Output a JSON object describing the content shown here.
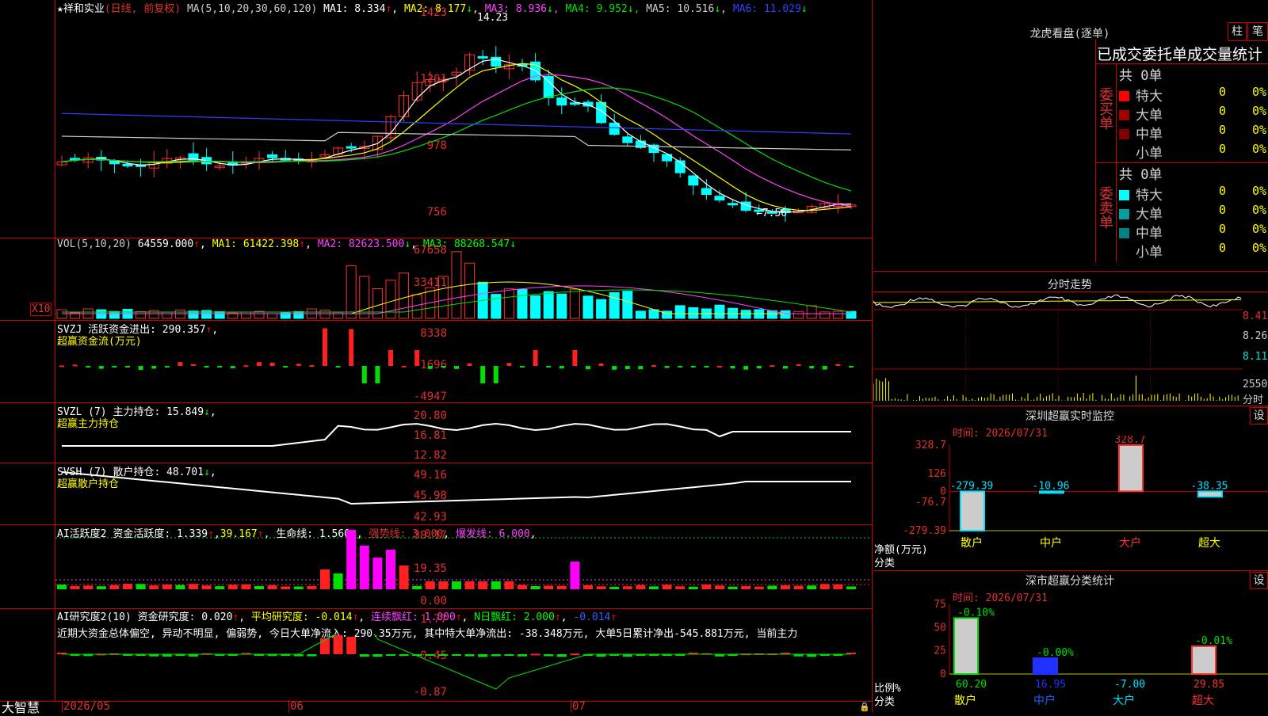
{
  "header": {
    "stock": "★祥和实业",
    "period": "(日线, 前复权)",
    "ma_params": "MA(5,10,20,30,60,120)",
    "ma": [
      {
        "label": "MA1: 8.334",
        "arrow": "↑",
        "color": "#ffffff"
      },
      {
        "label": "MA2: 8.177",
        "arrow": "↓",
        "color": "#ffff00"
      },
      {
        "label": "MA3: 8.936",
        "arrow": "↓",
        "color": "#ff40ff"
      },
      {
        "label": "MA4: 9.952",
        "arrow": "↓",
        "color": "#00e000"
      },
      {
        "label": "MA5: 10.516",
        "arrow": "↓",
        "color": "#cccccc"
      },
      {
        "label": "MA6: 11.029",
        "arrow": "↓",
        "color": "#3040ff"
      }
    ],
    "high_mark": "14.23",
    "low_mark": "←7.56"
  },
  "kline": {
    "yticks": [
      "1423",
      "1201",
      "978",
      "756"
    ]
  },
  "vol": {
    "params": "VOL(5,10,20)",
    "value": "64559.000",
    "ma1": "MA1: 61422.398",
    "ma2": "MA2: 82623.500",
    "ma3": "MA3: 88268.547",
    "yticks": [
      "67658",
      "33411"
    ],
    "unit": "X10"
  },
  "svzj": {
    "line1": "SVZJ  活跃资金进出: 290.357",
    "arrow": "↑",
    "line2": "超赢资金流(万元)",
    "yticks": [
      "8338",
      "1696",
      "-4947"
    ]
  },
  "svzl": {
    "line1": "SVZL (7) 主力持仓: 15.849",
    "arrow": "↓",
    "line2": "超赢主力持仓",
    "yticks": [
      "20.80",
      "16.81",
      "12.82"
    ]
  },
  "svsh": {
    "line1": "SVSH (7) 散户持仓: 48.701",
    "arrow": "↓",
    "line2": "超赢散户持仓",
    "yticks": [
      "49.16",
      "45.98",
      "42.93"
    ]
  },
  "ai1": {
    "name": "AI活跃度2",
    "f1": "资金活跃度: 1.339",
    "f2": "39.167",
    "f3": "生命线: 1.560",
    "f4": "强势线: 3.000",
    "f5": "爆发线: 6.000",
    "yticks": [
      "39.17",
      "19.35",
      "0.00"
    ]
  },
  "ai2": {
    "name": "AI研究度2(10)",
    "f1": "资金研究度: 0.020",
    "f2": "平均研究度: -0.014",
    "f3": "连续飘红: 1.000",
    "f4": "N日飘红: 2.000",
    "f5": "-0.014",
    "text": "近期大资金总体偏空, 异动不明显, 偏弱势, 今日大单净流入: 290.35万元, 其中特大单净流出: -38.348万元, 大单5日累计净出-545.881万元, 当前主力",
    "yticks": [
      "1.77",
      "0.45",
      "-0.87"
    ]
  },
  "xaxis": {
    "labels": [
      "2026/05",
      "06",
      "07"
    ],
    "brand": "大智慧"
  },
  "right": {
    "lhb": {
      "title": "龙虎看盘(逐单)",
      "btn1": "柱",
      "btn2": "笔",
      "subtitle": "已成交委托单成交量统计",
      "buy": {
        "side": "委买单",
        "total": "共 0单",
        "rows": [
          {
            "name": "特大",
            "v": "0",
            "p": "0%",
            "c": "#ff0000"
          },
          {
            "name": "大单",
            "v": "0",
            "p": "0%",
            "c": "#a00000"
          },
          {
            "name": "中单",
            "v": "0",
            "p": "0%",
            "c": "#800000"
          },
          {
            "name": "小单",
            "v": "0",
            "p": "0%",
            "c": "#000000"
          }
        ]
      },
      "sell": {
        "side": "委卖单",
        "total": "共 0单",
        "rows": [
          {
            "name": "特大",
            "v": "0",
            "p": "0%",
            "c": "#00ffff"
          },
          {
            "name": "大单",
            "v": "0",
            "p": "0%",
            "c": "#00a0a0"
          },
          {
            "name": "中单",
            "v": "0",
            "p": "0%",
            "c": "#008080"
          },
          {
            "name": "小单",
            "v": "0",
            "p": "0%",
            "c": "#000000"
          }
        ]
      }
    },
    "fenshi": {
      "title": "分时走势",
      "yticks": [
        "8.41",
        "8.26",
        "8.11"
      ],
      "vol_tick": "2550",
      "vol_unit": "分时"
    },
    "monitor": {
      "title": "深圳超赢实时监控",
      "btn": "设",
      "time": "时间: 2026/07/31",
      "yticks": [
        "328.7",
        "126",
        "0",
        "-76.7",
        "-279.39"
      ],
      "ylabel": "净额(万元)",
      "xlabel": "分类"
    },
    "classify": {
      "title": "深市超赢分类统计",
      "btn": "设",
      "time": "时间: 2026/07/31",
      "yticks": [
        "75",
        "50",
        "25",
        "0"
      ],
      "ylabel": "比例%",
      "xlabel": "分类"
    }
  },
  "chart_data": [
    {
      "type": "bar",
      "title": "深圳超赢实时监控",
      "categories": [
        "散户",
        "中户",
        "大户",
        "超大"
      ],
      "values": [
        -279.39,
        -10.96,
        328.7,
        -38.35
      ],
      "ylabel": "净额(万元)",
      "xlabel": "分类",
      "ylim": [
        -279.39,
        328.7
      ]
    },
    {
      "type": "bar",
      "title": "深市超赢分类统计",
      "categories": [
        "散户",
        "中户",
        "大户",
        "超大"
      ],
      "values": [
        60.2,
        16.95,
        -7.0,
        29.85
      ],
      "labels": [
        "-0.10%",
        "-0.00%",
        "",
        "-0.01%"
      ],
      "ylabel": "比例%",
      "xlabel": "分类",
      "ylim": [
        0,
        75
      ]
    }
  ]
}
